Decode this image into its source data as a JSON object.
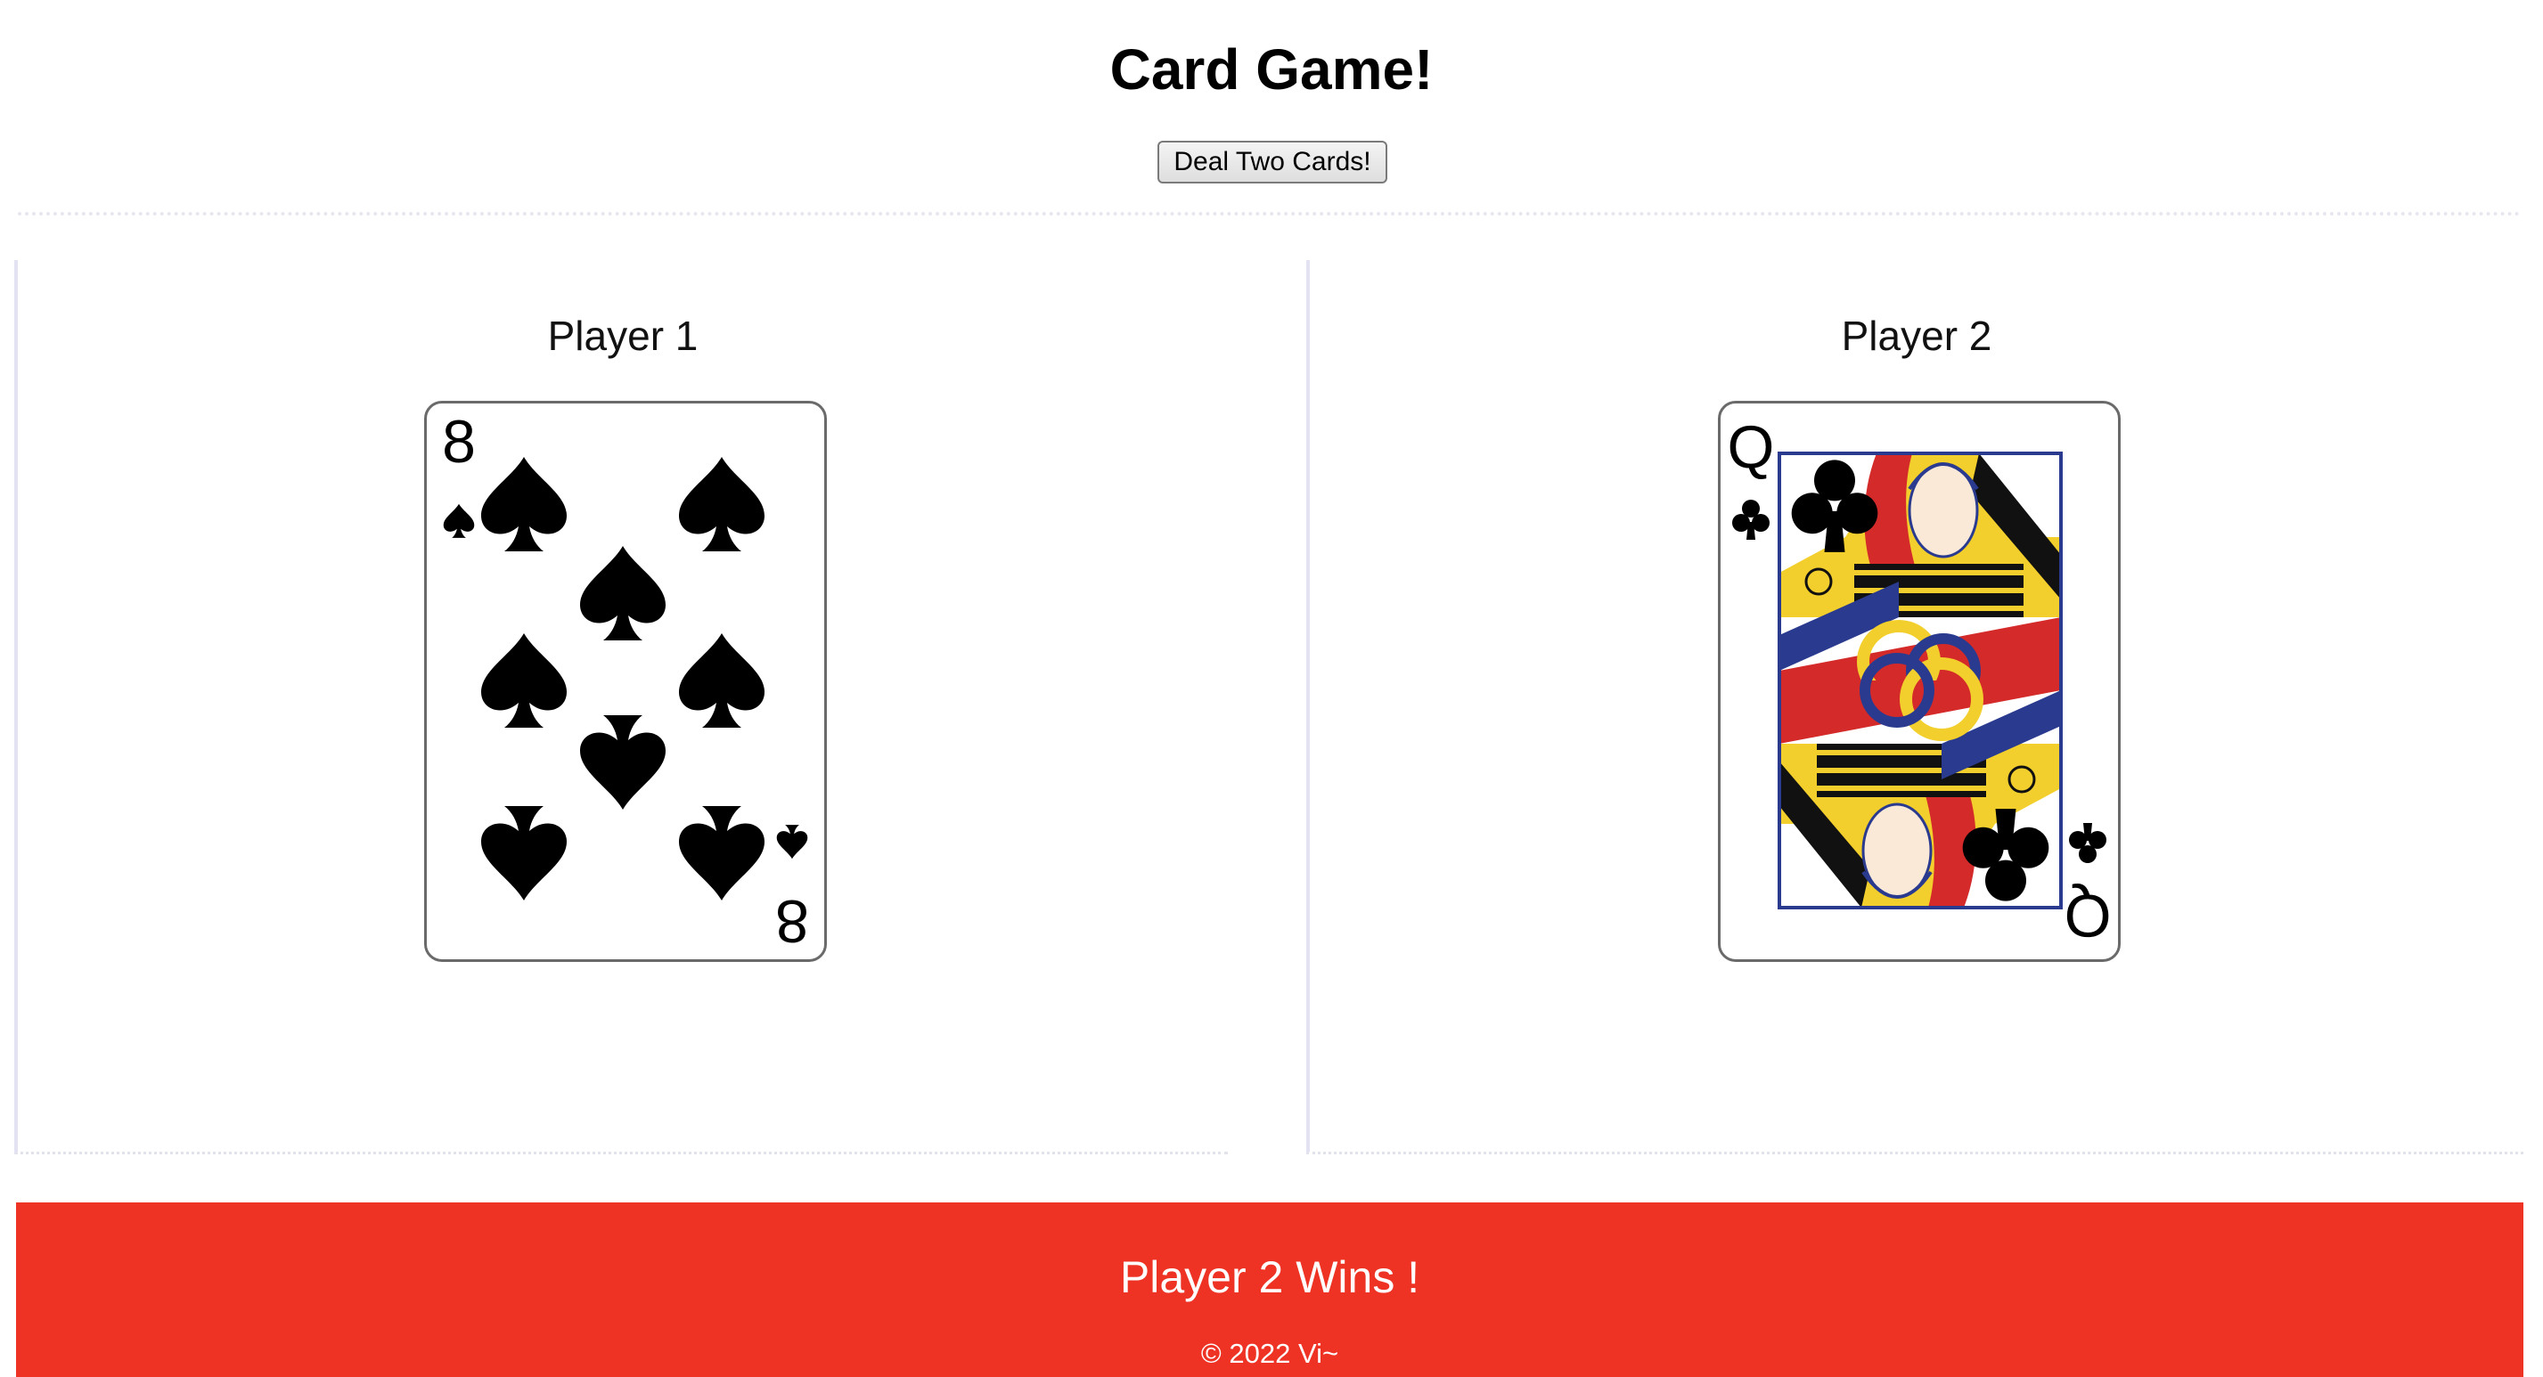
{
  "header": {
    "title": "Card Game!",
    "deal_button_label": "Deal Two Cards!"
  },
  "players": [
    {
      "label": "Player 1",
      "card": {
        "rank": "8",
        "suit": "spades",
        "icon": "eight-of-spades-card-icon"
      }
    },
    {
      "label": "Player 2",
      "card": {
        "rank": "Q",
        "suit": "clubs",
        "icon": "queen-of-clubs-card-icon"
      }
    }
  ],
  "result": {
    "message": "Player 2 Wins !",
    "footer": "© 2022 Vi~"
  },
  "colors": {
    "banner": "#ee3224",
    "card_border": "#6a6a6a",
    "queen_frame": "#2a3b8f",
    "queen_red": "#d42a2a",
    "queen_gold": "#f2cf2c"
  }
}
